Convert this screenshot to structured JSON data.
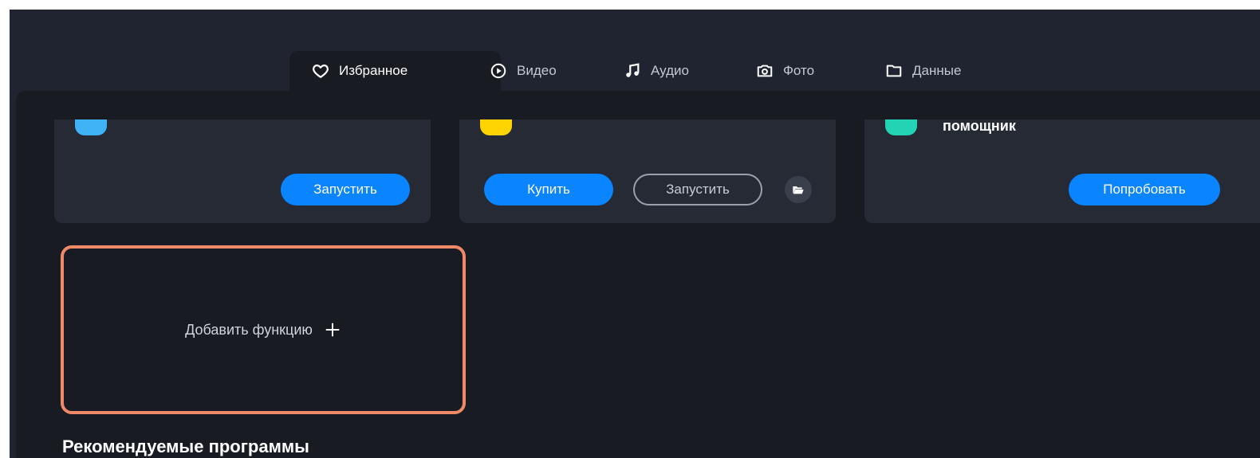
{
  "tabs": [
    {
      "label": "Избранное",
      "icon": "heart-icon",
      "active": true
    },
    {
      "label": "Видео",
      "icon": "play-circle-icon",
      "active": false
    },
    {
      "label": "Аудио",
      "icon": "music-note-icon",
      "active": false
    },
    {
      "label": "Фото",
      "icon": "camera-icon",
      "active": false
    },
    {
      "label": "Данные",
      "icon": "folder-icon",
      "active": false
    }
  ],
  "cards": [
    {
      "icon_color": "#3fb3f5",
      "title": "",
      "buttons": [
        {
          "label": "Запустить",
          "style": "primary"
        }
      ]
    },
    {
      "icon_color": "#ffd400",
      "title": "",
      "buttons": [
        {
          "label": "Купить",
          "style": "primary"
        },
        {
          "label": "Запустить",
          "style": "outline"
        }
      ],
      "extra_icon": "folder-open-icon"
    },
    {
      "icon_color": "#22d3b4",
      "title": "помощник",
      "buttons": [
        {
          "label": "Попробовать",
          "style": "primary"
        }
      ]
    }
  ],
  "add_feature": {
    "label": "Добавить функцию",
    "icon": "plus-icon",
    "highlight_color": "#f08968"
  },
  "section_heading": "Рекомендуемые программы",
  "colors": {
    "accent": "#0a84ff",
    "background": "#191b23",
    "card": "#262a35"
  }
}
